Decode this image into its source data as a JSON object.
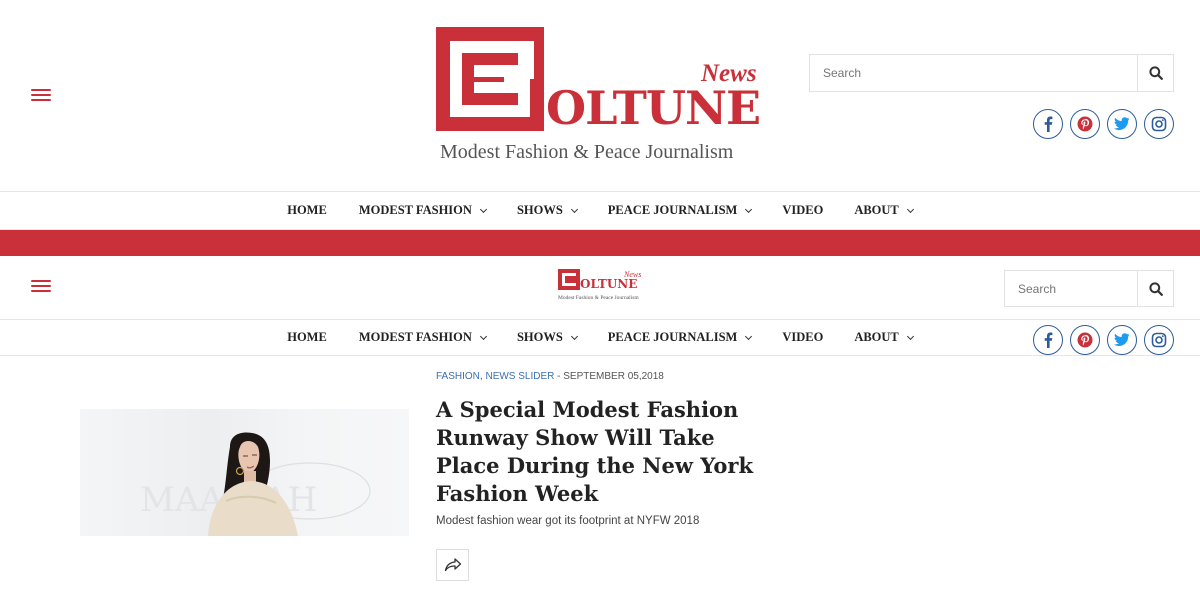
{
  "logo": {
    "wordmark": "OLTUNE",
    "news": "News",
    "tagline": "Modest Fashion & Peace Journalism"
  },
  "search": {
    "placeholder": "Search"
  },
  "socials": [
    {
      "name": "facebook",
      "color": "#2d5c9c"
    },
    {
      "name": "pinterest",
      "color": "#c9303a"
    },
    {
      "name": "twitter",
      "color": "#1d9bf0"
    },
    {
      "name": "instagram",
      "color": "#2d5c9c"
    }
  ],
  "nav": {
    "items": [
      {
        "label": "HOME",
        "dropdown": false
      },
      {
        "label": "MODEST FASHION",
        "dropdown": true
      },
      {
        "label": "SHOWS",
        "dropdown": true
      },
      {
        "label": "PEACE JOURNALISM",
        "dropdown": true
      },
      {
        "label": "VIDEO",
        "dropdown": false
      },
      {
        "label": "ABOUT",
        "dropdown": true
      }
    ]
  },
  "colors": {
    "brand_red": "#c9303a",
    "link_blue": "#3b6fb6",
    "icon_blue": "#2d5c9c"
  },
  "article": {
    "category_1": "FASHION",
    "separator": ",",
    "category_2": "NEWS SLIDER",
    "date": "- SEPTEMBER 05,2018",
    "title": "A Special Modest Fashion Runway Show Will Take Place During the New York Fashion Week",
    "excerpt": "Modest fashion wear got its footprint at NYFW 2018",
    "image_watermark": "MAARIAH"
  }
}
